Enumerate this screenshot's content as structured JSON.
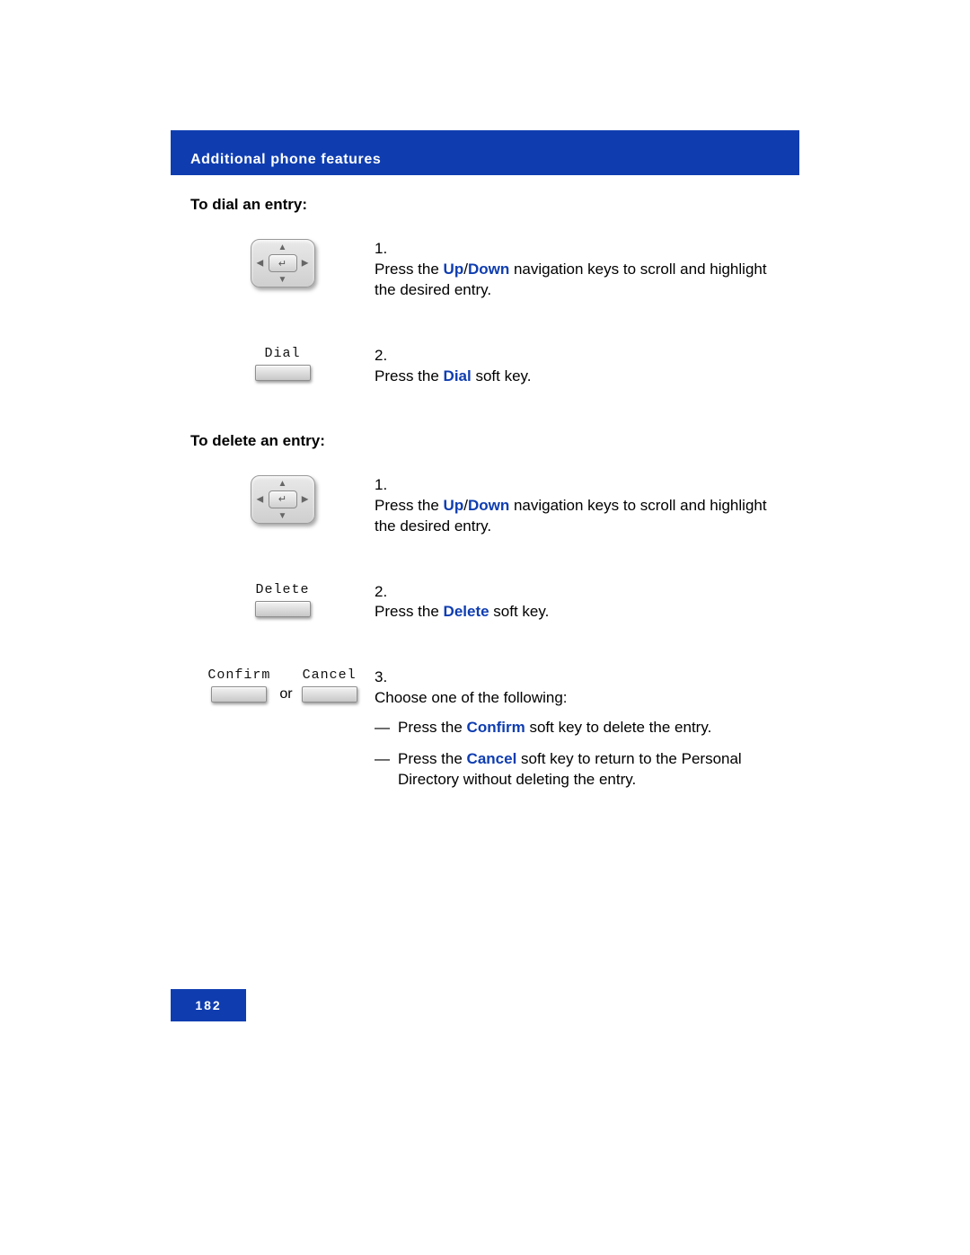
{
  "header": {
    "title": "Additional phone features"
  },
  "colors": {
    "accent": "#0f3db0"
  },
  "section1_title": "To dial an entry:",
  "section2_title": "To delete an entry:",
  "soft": {
    "dial": "Dial",
    "delete": "Delete",
    "confirm": "Confirm",
    "cancel": "Cancel",
    "or": "or"
  },
  "step1": {
    "num": "1.",
    "pre": "Press the ",
    "hl1": "Up",
    "slash": "/",
    "hl2": "Down",
    "post": " navigation keys to scroll and highlight the desired entry."
  },
  "step2": {
    "num": "2.",
    "pre": "Press the ",
    "hl": "Dial",
    "post": " soft key."
  },
  "step3": {
    "num": "1.",
    "pre": "Press the ",
    "hl1": "Up",
    "slash": "/",
    "hl2": "Down",
    "post": " navigation keys to scroll and highlight the desired entry."
  },
  "step4": {
    "num": "2.",
    "pre": "Press the ",
    "hl": "Delete",
    "post": " soft key."
  },
  "step5": {
    "num": "3.",
    "intro": "Choose one of the following:",
    "a_pre": "Press the ",
    "a_hl": "Confirm",
    "a_post": " soft key to delete the entry.",
    "b_pre": "Press the ",
    "b_hl": "Cancel",
    "b_post": " soft key to return to the Personal Directory without deleting the entry."
  },
  "page_number": "182"
}
